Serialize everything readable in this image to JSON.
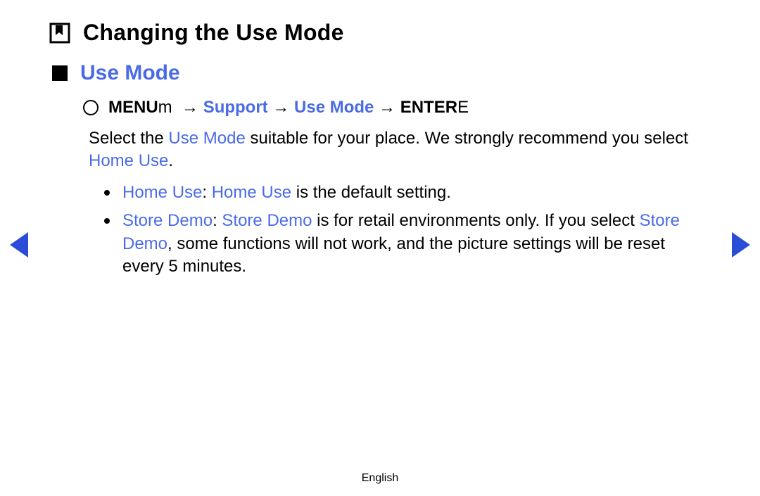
{
  "title": "Changing the Use Mode",
  "section": "Use Mode",
  "nav": {
    "menu": "MENU",
    "menu_suffix": "m",
    "arrow": "→",
    "support": "Support",
    "use_mode": "Use Mode",
    "enter": "ENTER",
    "enter_suffix": "E"
  },
  "intro": {
    "p1a": "Select the ",
    "p1_hl1": "Use Mode",
    "p1b": " suitable for your place. We strongly recommend you select ",
    "p1_hl2": "Home Use",
    "p1c": "."
  },
  "bullets": {
    "b1": {
      "hl1": "Home Use",
      "sep": ": ",
      "hl2": "Home Use",
      "rest": " is the default setting."
    },
    "b2": {
      "hl1": "Store Demo",
      "sep": ": ",
      "hl2": "Store Demo",
      "mid": " is for retail environments only. If you select ",
      "hl3": "Store Demo",
      "rest": ", some functions will not work, and the picture settings will be reset every 5 minutes."
    }
  },
  "footer": "English"
}
